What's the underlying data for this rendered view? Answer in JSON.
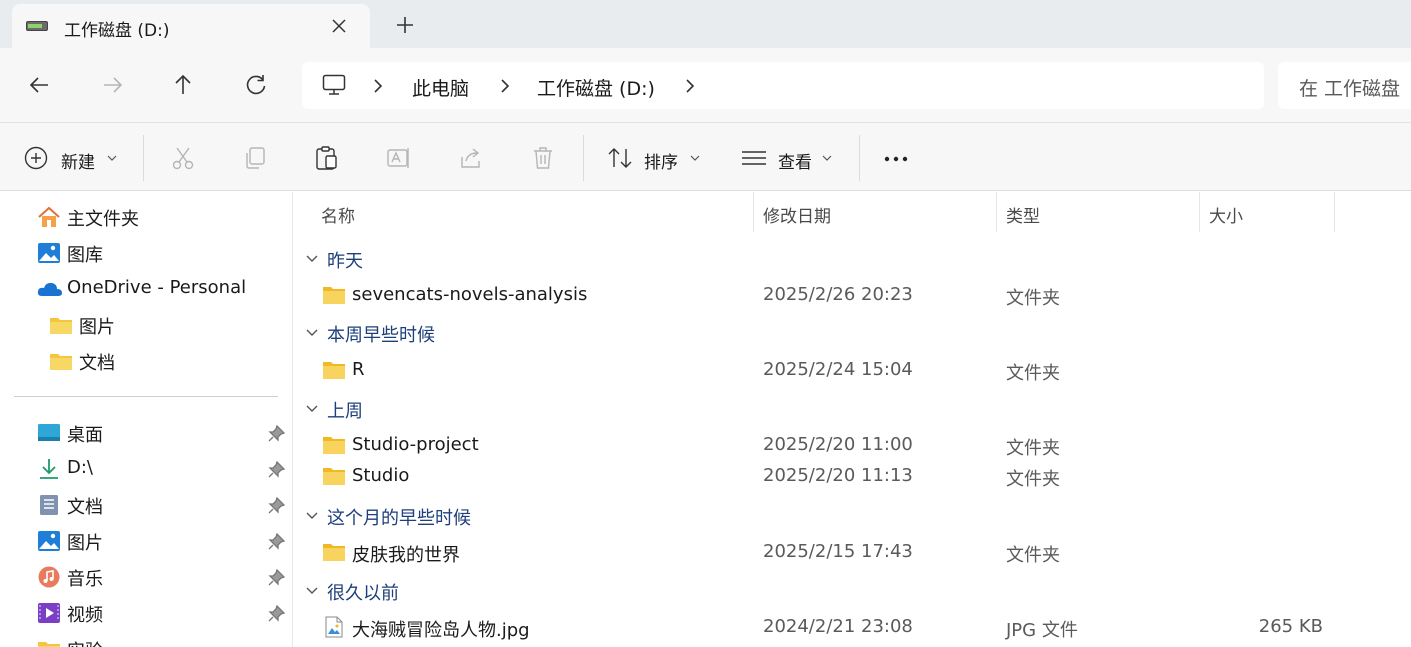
{
  "tab": {
    "title": "工作磁盘 (D:)",
    "close_icon": "close-icon",
    "drive_icon": "drive-icon",
    "new_tab_icon": "plus-icon"
  },
  "address": {
    "crumbs": [
      "此电脑",
      "工作磁盘 (D:)"
    ],
    "root_icon": "computer-icon",
    "search_placeholder": "在 工作磁盘"
  },
  "toolbar": {
    "new_label": "新建",
    "sort_label": "排序",
    "view_label": "查看",
    "icons": [
      "new-icon",
      "cut-icon",
      "copy-icon",
      "paste-icon",
      "rename-icon",
      "share-icon",
      "delete-icon",
      "sort-icon",
      "view-icon",
      "more-icon"
    ]
  },
  "sidebar": {
    "top_items": [
      {
        "label": "主文件夹",
        "icon": "home-icon"
      },
      {
        "label": "图库",
        "icon": "gallery-icon"
      },
      {
        "label": "OneDrive - Personal",
        "icon": "onedrive-icon"
      },
      {
        "label": "图片",
        "icon": "folder-icon"
      },
      {
        "label": "文档",
        "icon": "folder-icon"
      }
    ],
    "pinned_items": [
      {
        "label": "桌面",
        "icon": "desktop-icon"
      },
      {
        "label": "D:\\",
        "icon": "download-icon"
      },
      {
        "label": "文档",
        "icon": "documents-icon"
      },
      {
        "label": "图片",
        "icon": "pictures-icon"
      },
      {
        "label": "音乐",
        "icon": "music-icon"
      },
      {
        "label": "视频",
        "icon": "video-icon"
      },
      {
        "label": "实验",
        "icon": "folder-icon"
      }
    ]
  },
  "columns": {
    "name": "名称",
    "date": "修改日期",
    "type": "类型",
    "size": "大小"
  },
  "groups": [
    {
      "label": "昨天",
      "files": [
        {
          "name": "sevencats-novels-analysis",
          "date": "2025/2/26 20:23",
          "type": "文件夹",
          "size": "",
          "icon": "folder-icon"
        }
      ]
    },
    {
      "label": "本周早些时候",
      "files": [
        {
          "name": "R",
          "date": "2025/2/24 15:04",
          "type": "文件夹",
          "size": "",
          "icon": "folder-icon"
        }
      ]
    },
    {
      "label": "上周",
      "files": [
        {
          "name": "Studio-project",
          "date": "2025/2/20 11:00",
          "type": "文件夹",
          "size": "",
          "icon": "folder-icon"
        },
        {
          "name": "Studio",
          "date": "2025/2/20 11:13",
          "type": "文件夹",
          "size": "",
          "icon": "folder-icon"
        }
      ]
    },
    {
      "label": "这个月的早些时候",
      "files": [
        {
          "name": "皮肤我的世界",
          "date": "2025/2/15 17:43",
          "type": "文件夹",
          "size": "",
          "icon": "folder-icon"
        }
      ]
    },
    {
      "label": "很久以前",
      "files": [
        {
          "name": "大海贼冒险岛人物.jpg",
          "date": "2024/2/21 23:08",
          "type": "JPG 文件",
          "size": "265 KB",
          "icon": "image-file-icon"
        }
      ]
    }
  ],
  "colors": {
    "accent": "#1e3f7a",
    "folder": "#f4c63d",
    "tab_strip": "#e9ecef",
    "chrome": "#f7f7f7"
  }
}
